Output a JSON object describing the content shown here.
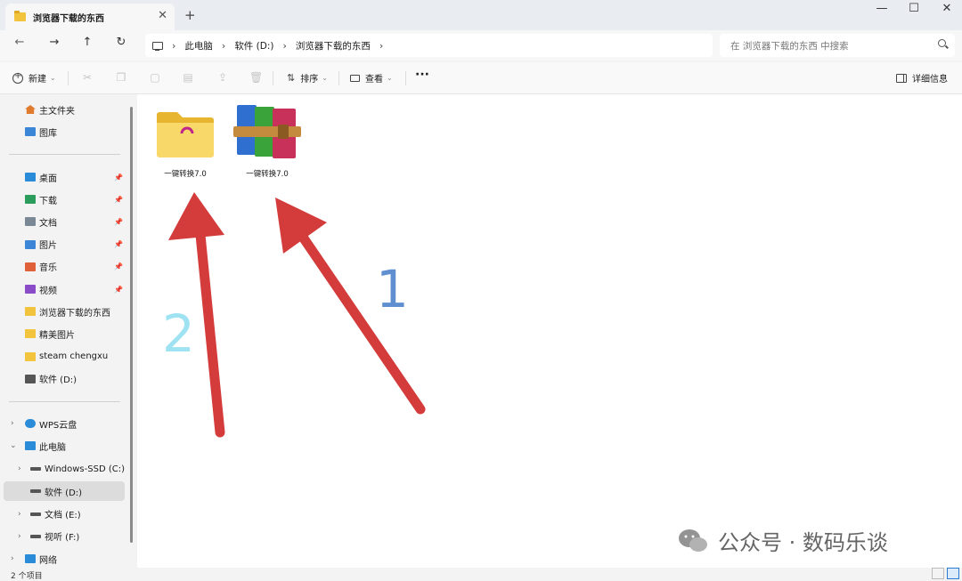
{
  "window": {
    "tab_title": "浏览器下载的东西",
    "tab_close": "✕",
    "new_tab": "+",
    "minimize": "—",
    "maximize": "☐",
    "close": "✕"
  },
  "nav": {
    "back": "←",
    "forward": "→",
    "up": "↑",
    "refresh": "↻",
    "breadcrumb": [
      "此电脑",
      "软件 (D:)",
      "浏览器下载的东西"
    ],
    "search_placeholder": "在 浏览器下载的东西 中搜索"
  },
  "toolbar": {
    "new_label": "新建",
    "sort_label": "排序",
    "view_label": "查看",
    "more": "···",
    "details_label": "详细信息"
  },
  "sidebar": {
    "home": "主文件夹",
    "gallery": "图库",
    "quick": [
      {
        "label": "桌面",
        "color": "#2a8bd8",
        "pinned": true
      },
      {
        "label": "下载",
        "color": "#2a9d5c",
        "pinned": true
      },
      {
        "label": "文档",
        "color": "#7a8896",
        "pinned": true
      },
      {
        "label": "图片",
        "color": "#3b86d6",
        "pinned": true
      },
      {
        "label": "音乐",
        "color": "#e0603a",
        "pinned": true
      },
      {
        "label": "视频",
        "color": "#8a4bc8",
        "pinned": true
      },
      {
        "label": "浏览器下载的东西",
        "color": "#f2c33d",
        "pinned": false
      },
      {
        "label": "精美图片",
        "color": "#f2c33d",
        "pinned": false
      },
      {
        "label": "steam chengxu",
        "color": "#f2c33d",
        "pinned": false
      },
      {
        "label": "软件 (D:)",
        "color": "#555555",
        "pinned": false
      }
    ],
    "wps": "WPS云盘",
    "this_pc": "此电脑",
    "drives": [
      {
        "label": "Windows-SSD (C:)",
        "selected": false
      },
      {
        "label": "软件 (D:)",
        "selected": true
      },
      {
        "label": "文档 (E:)",
        "selected": false
      },
      {
        "label": "视听 (F:)",
        "selected": false
      }
    ],
    "network": "网络"
  },
  "files": [
    {
      "label": "一键转换7.0",
      "type": "folder"
    },
    {
      "label": "一键转换7.0",
      "type": "archive"
    }
  ],
  "annotations": {
    "num1": "1",
    "num1_color": "#5f8fd0",
    "num2": "2",
    "num2_color": "#9fe3f2",
    "arrow_color": "#d43b3b"
  },
  "watermark": "公众号 · 数码乐谈",
  "status": "2 个项目"
}
